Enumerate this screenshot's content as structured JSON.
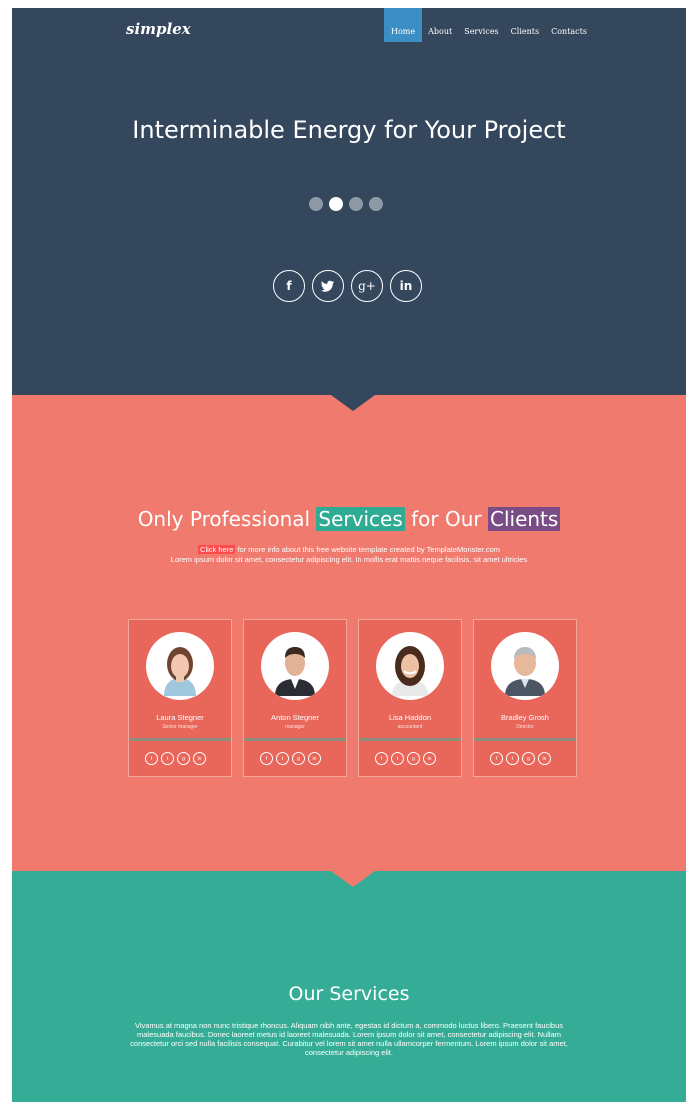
{
  "brand": {
    "logo": "simplex"
  },
  "nav": {
    "items": [
      "Home",
      "About",
      "Services",
      "Clients",
      "Contacts"
    ],
    "active": 0
  },
  "hero": {
    "title": "Interminable Energy for Your Project",
    "slider_dots": 4,
    "slider_active": 1,
    "socials": [
      {
        "icon": "facebook-icon",
        "glyph": "f"
      },
      {
        "icon": "twitter-icon",
        "glyph": "t"
      },
      {
        "icon": "google-plus-icon",
        "glyph": "g+"
      },
      {
        "icon": "linkedin-icon",
        "glyph": "in"
      }
    ]
  },
  "team": {
    "title_part1": "Only Professional ",
    "title_highlight1": "Services",
    "title_part2": " for Our ",
    "title_highlight2": "Clients",
    "link_text": "Click here",
    "text_line1": " for more info about this free website template created by TemplateMonster.com",
    "text_line2": "Lorem ipsum dolor sit amet, consectetur adipiscing elit. In mollis erat mattis neque facilisis, sit amet ultricies",
    "members": [
      {
        "name": "Laura Stegner",
        "role": "Senior manager"
      },
      {
        "name": "Anton Stegner",
        "role": "manager"
      },
      {
        "name": "Lisa Haddon",
        "role": "accountant"
      },
      {
        "name": "Bradley Grosh",
        "role": "Director"
      }
    ],
    "member_social_glyphs": [
      "f",
      "t",
      "g",
      "in"
    ]
  },
  "services": {
    "title": "Our Services",
    "text": "Vivamus at magna non nunc tristique rhoncus. Aliquam nibh ante, egestas id dictum a, commodo luctus libero. Praesent faucibus malesuada faucibus. Donec laoreet metus id laoreet malesuada. Lorem ipsum dolor sit amet, consectetur adipiscing elit. Nullam consectetur orci sed nulla facilisis consequat. Curabitur vel lorem sit amet nulla ullamcorper fermentum. Lorem ipsum dolor sit amet, consectetur adipiscing elit."
  },
  "colors": {
    "hero_bg": "#34475d",
    "team_bg": "#f07a6e",
    "services_bg": "#35ad96",
    "nav_active": "#3b8fc4",
    "highlight_green": "#2fab93",
    "highlight_purple": "#7a4c86"
  }
}
